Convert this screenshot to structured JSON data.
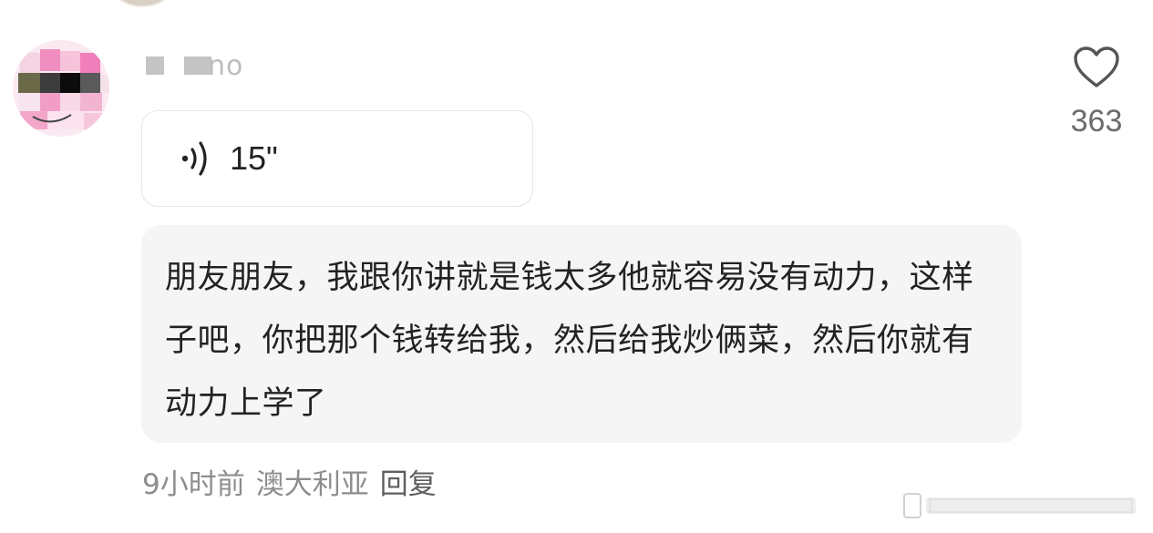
{
  "comment": {
    "username": "no",
    "voice_duration": "15\"",
    "text": "朋友朋友，我跟你讲就是钱太多他就容易没有动力，这样子吧，你把那个钱转给我，然后给我炒俩菜，然后你就有动力上学了",
    "time": "9小时前",
    "location": "澳大利亚",
    "reply_label": "回复",
    "like_count": "363"
  },
  "icons": {
    "voice": "voice-wave-icon",
    "like": "heart-outline-icon"
  },
  "colors": {
    "bubble_bg": "#f5f5f5",
    "meta_text": "#8e8e8e",
    "like_count": "#6b6b6b",
    "avatar_pink": "#f3a6c8"
  }
}
